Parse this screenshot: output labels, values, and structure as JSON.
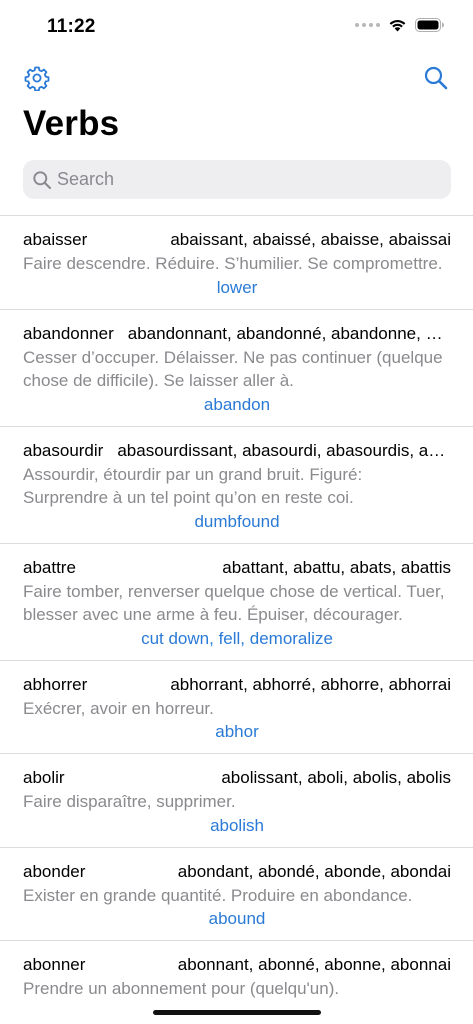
{
  "status_bar": {
    "time": "11:22"
  },
  "nav": {
    "left_icon": "gear-icon",
    "right_icon": "search-icon"
  },
  "title": "Verbs",
  "search": {
    "placeholder": "Search",
    "value": ""
  },
  "colors": {
    "accent": "#2a7ad6",
    "secondary_text": "#8a8a8e",
    "search_bg": "#eeeef0"
  },
  "verbs": [
    {
      "infinitive": "abaisser",
      "forms": "abaissant, abaissé, abaisse, abaissai",
      "definition": "Faire descendre. Réduire. S’humilier. Se compromettre.",
      "translation": "lower"
    },
    {
      "infinitive": "abandonner",
      "forms": "abandonnant, abandonné, abandonne, abandonnai",
      "definition": "Cesser d’occuper. Délaisser. Ne pas continuer (quelque chose de difficile). Se laisser aller à.",
      "translation": "abandon"
    },
    {
      "infinitive": "abasourdir",
      "forms": "abasourdissant, abasourdi, abasourdis, abasourdis",
      "definition": "Assourdir, étourdir par un grand bruit. Figuré: Surprendre à un tel point qu’on en reste coi.",
      "translation": "dumbfound"
    },
    {
      "infinitive": "abattre",
      "forms": "abattant, abattu, abats, abattis",
      "definition": "Faire tomber, renverser quelque chose de vertical. Tuer, blesser avec une arme à feu. Épuiser, décourager.",
      "translation": "cut down, fell, demoralize"
    },
    {
      "infinitive": "abhorrer",
      "forms": "abhorrant, abhorré, abhorre, abhorrai",
      "definition": "Exécrer, avoir en horreur.",
      "translation": "abhor"
    },
    {
      "infinitive": "abolir",
      "forms": "abolissant, aboli, abolis, abolis",
      "definition": "Faire disparaître, supprimer.",
      "translation": "abolish"
    },
    {
      "infinitive": "abonder",
      "forms": "abondant, abondé, abonde, abondai",
      "definition": "Exister en grande quantité. Produire en abondance.",
      "translation": "abound"
    },
    {
      "infinitive": "abonner",
      "forms": "abonnant, abonné, abonne, abonnai",
      "definition": "Prendre un abonnement pour (quelqu'un).",
      "translation": ""
    }
  ]
}
